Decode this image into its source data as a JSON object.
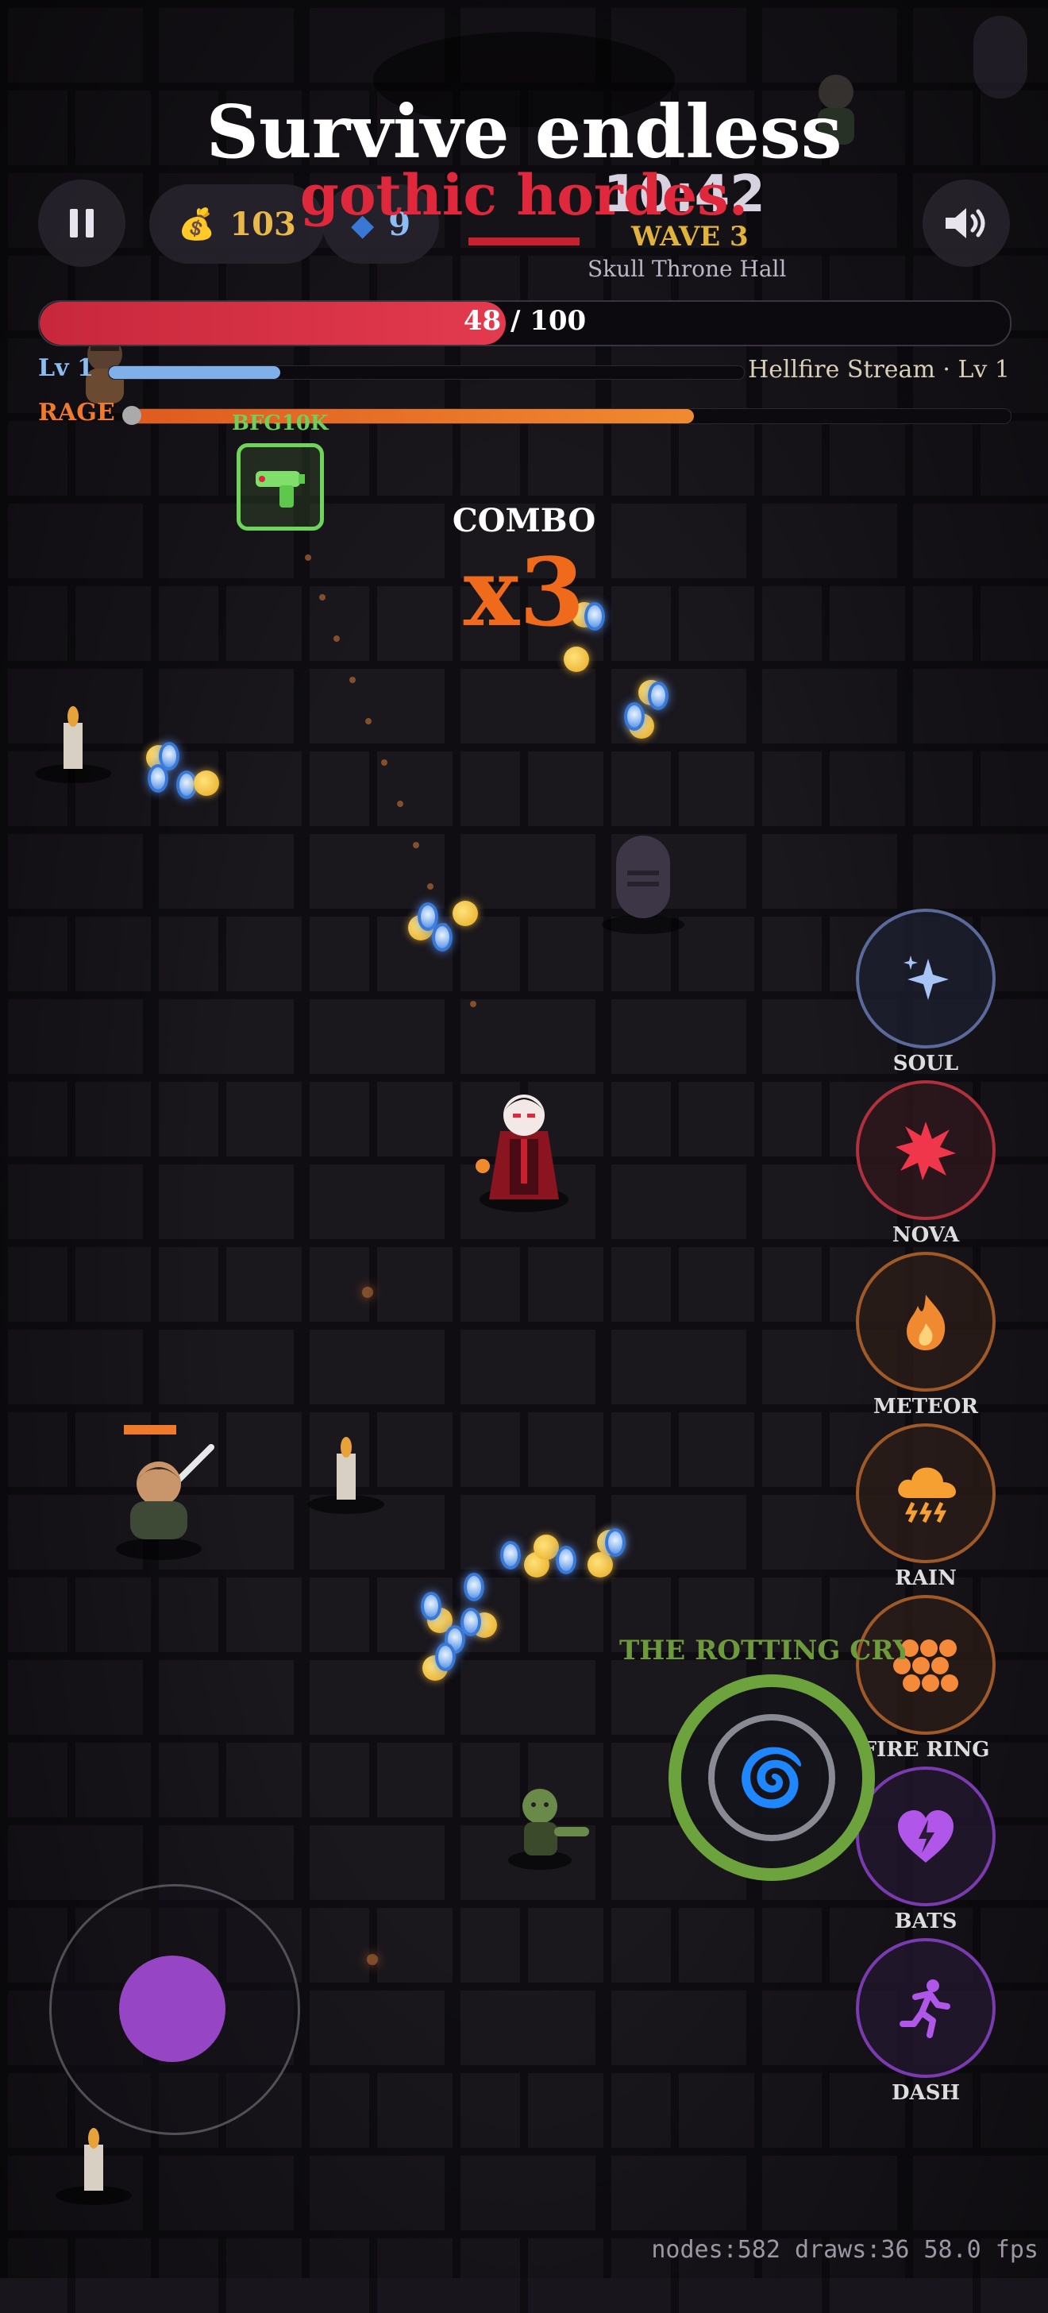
{
  "title": {
    "line1": "Survive endless",
    "line2": "gothic hordes."
  },
  "hud": {
    "gold": "103",
    "gems": "9",
    "timer": "10:42",
    "wave": "WAVE 3",
    "zone": "Skull Throne Hall",
    "hp_text": "48 / 100",
    "hp_fraction": 0.48,
    "level_label": "Lv 1",
    "xp_fraction": 0.27,
    "weapon": "Hellfire Stream · Lv 1",
    "rage_label": "RAGE",
    "rage_fraction": 0.64
  },
  "pickup": {
    "label": "BFG10K",
    "icon": "green-blaster-icon"
  },
  "combo": {
    "label": "COMBO",
    "value": "x3"
  },
  "skills": [
    {
      "label": "SOUL",
      "icon": "sparkle-icon",
      "color": "#5a6a9a"
    },
    {
      "label": "NOVA",
      "icon": "burst-icon",
      "color": "#b0303c"
    },
    {
      "label": "METEOR",
      "icon": "flame-icon",
      "color": "#a05a28"
    },
    {
      "label": "RAIN",
      "icon": "storm-cloud-icon",
      "color": "#a05a28"
    },
    {
      "label": "FIRE RING",
      "icon": "fire-ring-icon",
      "color": "#a05a28"
    },
    {
      "label": "BATS",
      "icon": "heart-bolt-icon",
      "color": "#7a3ab0"
    },
    {
      "label": "DASH",
      "icon": "running-icon",
      "color": "#7a3ab0"
    }
  ],
  "portal": {
    "label": "THE ROTTING CRYPT"
  },
  "debug": "nodes:582 draws:36  58.0 fps",
  "colors": {
    "accent_red": "#e0283c",
    "rage_orange": "#f07a2c",
    "xp_blue": "#7fb0ea"
  }
}
